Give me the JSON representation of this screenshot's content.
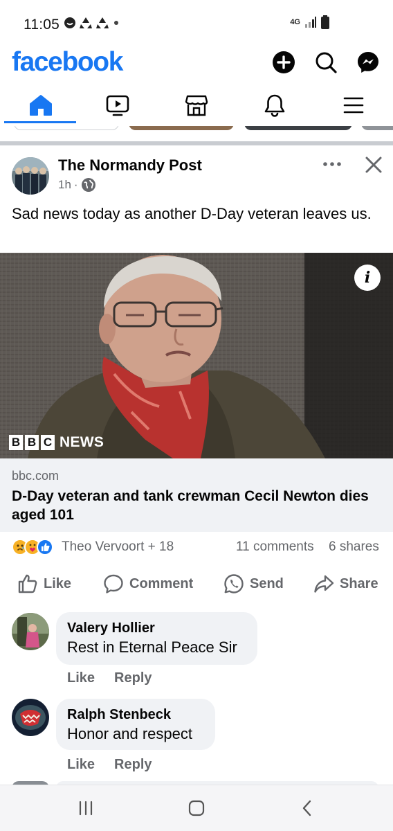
{
  "status_bar": {
    "time": "11:05",
    "network": "4G"
  },
  "header": {
    "logo_text": "facebook",
    "brand_color": "#1877f2"
  },
  "nav": {
    "tabs": [
      {
        "name": "home",
        "icon": "home-icon",
        "active": true
      },
      {
        "name": "video",
        "icon": "video-icon",
        "active": false
      },
      {
        "name": "marketplace",
        "icon": "marketplace-icon",
        "active": false
      },
      {
        "name": "notifications",
        "icon": "bell-icon",
        "active": false
      },
      {
        "name": "menu",
        "icon": "hamburger-menu-icon",
        "active": false
      }
    ]
  },
  "post": {
    "author": "The Normandy Post",
    "time": "1h",
    "separator": "·",
    "text": "Sad news today as another D-Day veteran leaves us.",
    "link": {
      "source_logo": [
        "B",
        "B",
        "C"
      ],
      "source_logo_suffix": "NEWS",
      "info_label": "i",
      "domain": "bbc.com",
      "title": "D-Day veteran and tank crewman Cecil Newton dies aged 101"
    },
    "reactions": {
      "names": "Theo Vervoort + 18",
      "comments": "11 comments",
      "shares": "6 shares"
    },
    "actions": {
      "like": "Like",
      "comment": "Comment",
      "send": "Send",
      "share": "Share"
    }
  },
  "comments": [
    {
      "name": "Valery Hollier",
      "text": "Rest in Eternal Peace Sir",
      "like": "Like",
      "reply": "Reply"
    },
    {
      "name": "Ralph Stenbeck",
      "text": "Honor and respect",
      "like": "Like",
      "reply": "Reply"
    }
  ]
}
